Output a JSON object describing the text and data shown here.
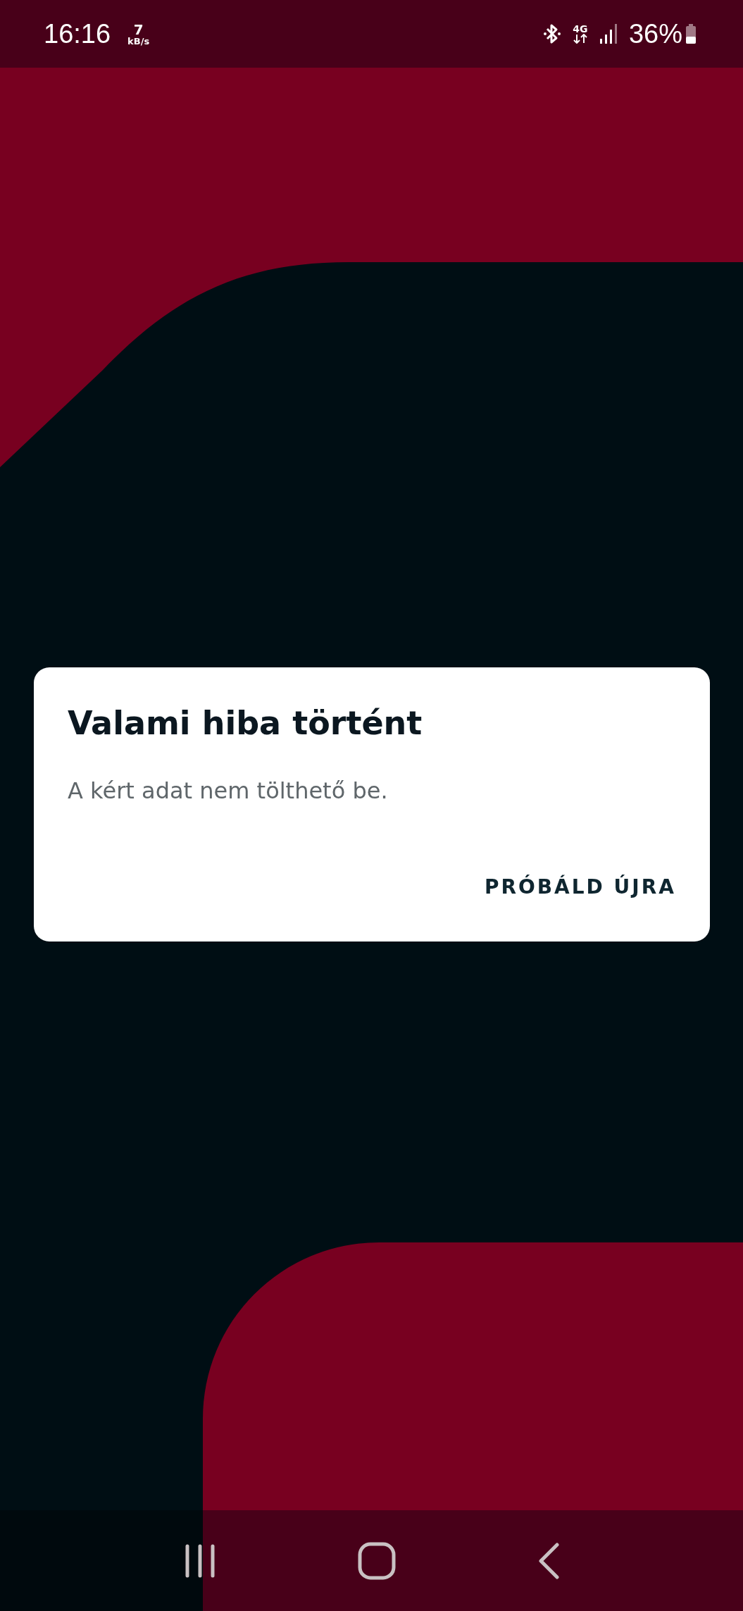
{
  "status_bar": {
    "time": "16:16",
    "net_speed_value": "7",
    "net_speed_unit": "kB/s",
    "network_type": "4G",
    "battery": "36%"
  },
  "dialog": {
    "title": "Valami hiba történt",
    "message": "A kért adat nem tölthető be.",
    "buttons": [
      "PRÓBÁLD ÚJRA"
    ]
  }
}
